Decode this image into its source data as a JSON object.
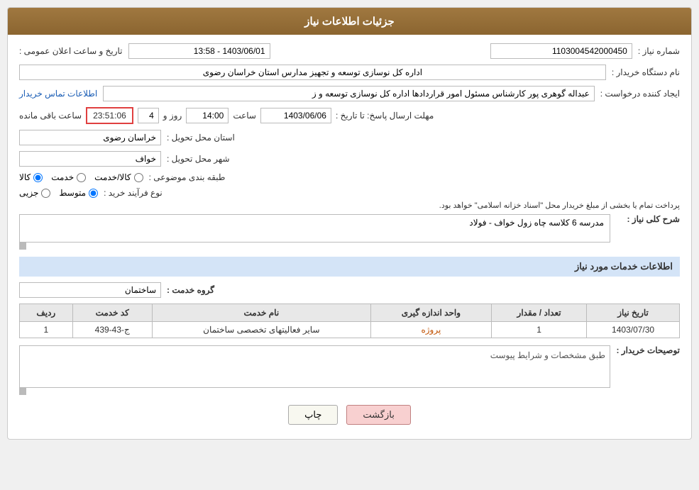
{
  "header": {
    "title": "جزئیات اطلاعات نیاز"
  },
  "fields": {
    "shomareNiaz_label": "شماره نیاز :",
    "shomareNiaz_value": "1103004542000450",
    "namDastgah_label": "نام دستگاه خریدار :",
    "namDastgah_value": "اداره کل نوسازی  توسعه و تجهیز مدارس استان خراسان رضوی",
    "ijadKonande_label": "ایجاد کننده درخواست :",
    "ijadKonande_value": "عبداله گوهری پور کارشناس مسئول امور قراردادها  اداره کل نوسازی  توسعه و ز",
    "ijadKonande_link": "اطلاعات تماس خریدار",
    "mohlat_label": "مهلت ارسال پاسخ: تا تاریخ :",
    "tarikh_value": "1403/06/06",
    "saat_label": "ساعت",
    "saat_value": "14:00",
    "rooz_label": "روز و",
    "rooz_value": "4",
    "baghimande_label": "ساعت باقی مانده",
    "countdown_value": "23:51:06",
    "ostan_label": "استان محل تحویل :",
    "ostan_value": "خراسان رضوی",
    "shahr_label": "شهر محل تحویل :",
    "shahr_value": "خواف",
    "tabaqebandi_label": "طبقه بندی موضوعی :",
    "tabaqebandi_options": [
      "کالا",
      "خدمت",
      "کالا/خدمت"
    ],
    "tabaqebandi_selected": "کالا",
    "noeFarayand_label": "نوع فرآیند خرید :",
    "noeFarayand_options": [
      "جزیی",
      "متوسط"
    ],
    "noeFarayand_selected": "متوسط",
    "noeFarayand_note": "پرداخت تمام یا بخشی از مبلغ خریدار محل \"اسناد خزانه اسلامی\" خواهد بود.",
    "sharhKoli_label": "شرح کلی نیاز :",
    "sharhKoli_value": "مدرسه 6 کلاسه چاه زول خواف - فولاد",
    "service_section": "اطلاعات خدمات مورد نیاز",
    "groupKhadmat_label": "گروه خدمت :",
    "groupKhadmat_value": "ساختمان",
    "table": {
      "headers": [
        "ردیف",
        "کد خدمت",
        "نام خدمت",
        "واحد اندازه گیری",
        "تعداد / مقدار",
        "تاریخ نیاز"
      ],
      "rows": [
        {
          "radif": "1",
          "kodKhadmat": "ج-43-439",
          "namKhadmat": "سایر فعالیتهای تخصصی ساختمان",
          "vahed": "پروژه",
          "tedad": "1",
          "tarikh": "1403/07/30"
        }
      ]
    },
    "tvsifat_label": "توصیحات خریدار :",
    "tvsifat_value": "طبق مشخصات و شرایط پیوست",
    "public_date_label": "تاریخ و ساعت اعلان عمومی :",
    "public_date_value": "1403/06/01 - 13:58"
  },
  "buttons": {
    "print": "چاپ",
    "back": "بازگشت"
  }
}
